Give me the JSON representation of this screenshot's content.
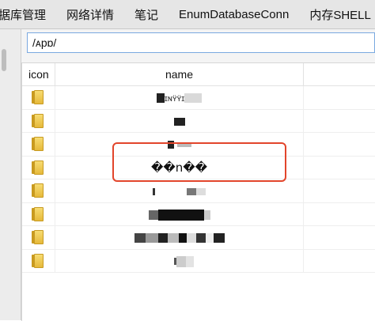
{
  "menubar": {
    "items": [
      "据库管理",
      "网络详情",
      "笔记",
      "EnumDatabaseConn",
      "内存SHELL"
    ]
  },
  "path_input": {
    "value": "/ᴀpɒ/"
  },
  "table": {
    "columns": {
      "icon": "icon",
      "name": "name"
    },
    "rows": [
      {
        "icon": "folder-icon",
        "name": "ɪɴʏ̈ʏ̈ɪ"
      },
      {
        "icon": "folder-icon",
        "name": ""
      },
      {
        "icon": "folder-icon",
        "name": ""
      },
      {
        "icon": "folder-icon",
        "name": "��n��"
      },
      {
        "icon": "folder-icon",
        "name": ""
      },
      {
        "icon": "folder-icon",
        "name": ""
      },
      {
        "icon": "folder-icon",
        "name": ""
      },
      {
        "icon": "folder-icon",
        "name": ""
      }
    ]
  },
  "colors": {
    "annotation": "#e2452b",
    "input_border": "#7aa9e0"
  }
}
